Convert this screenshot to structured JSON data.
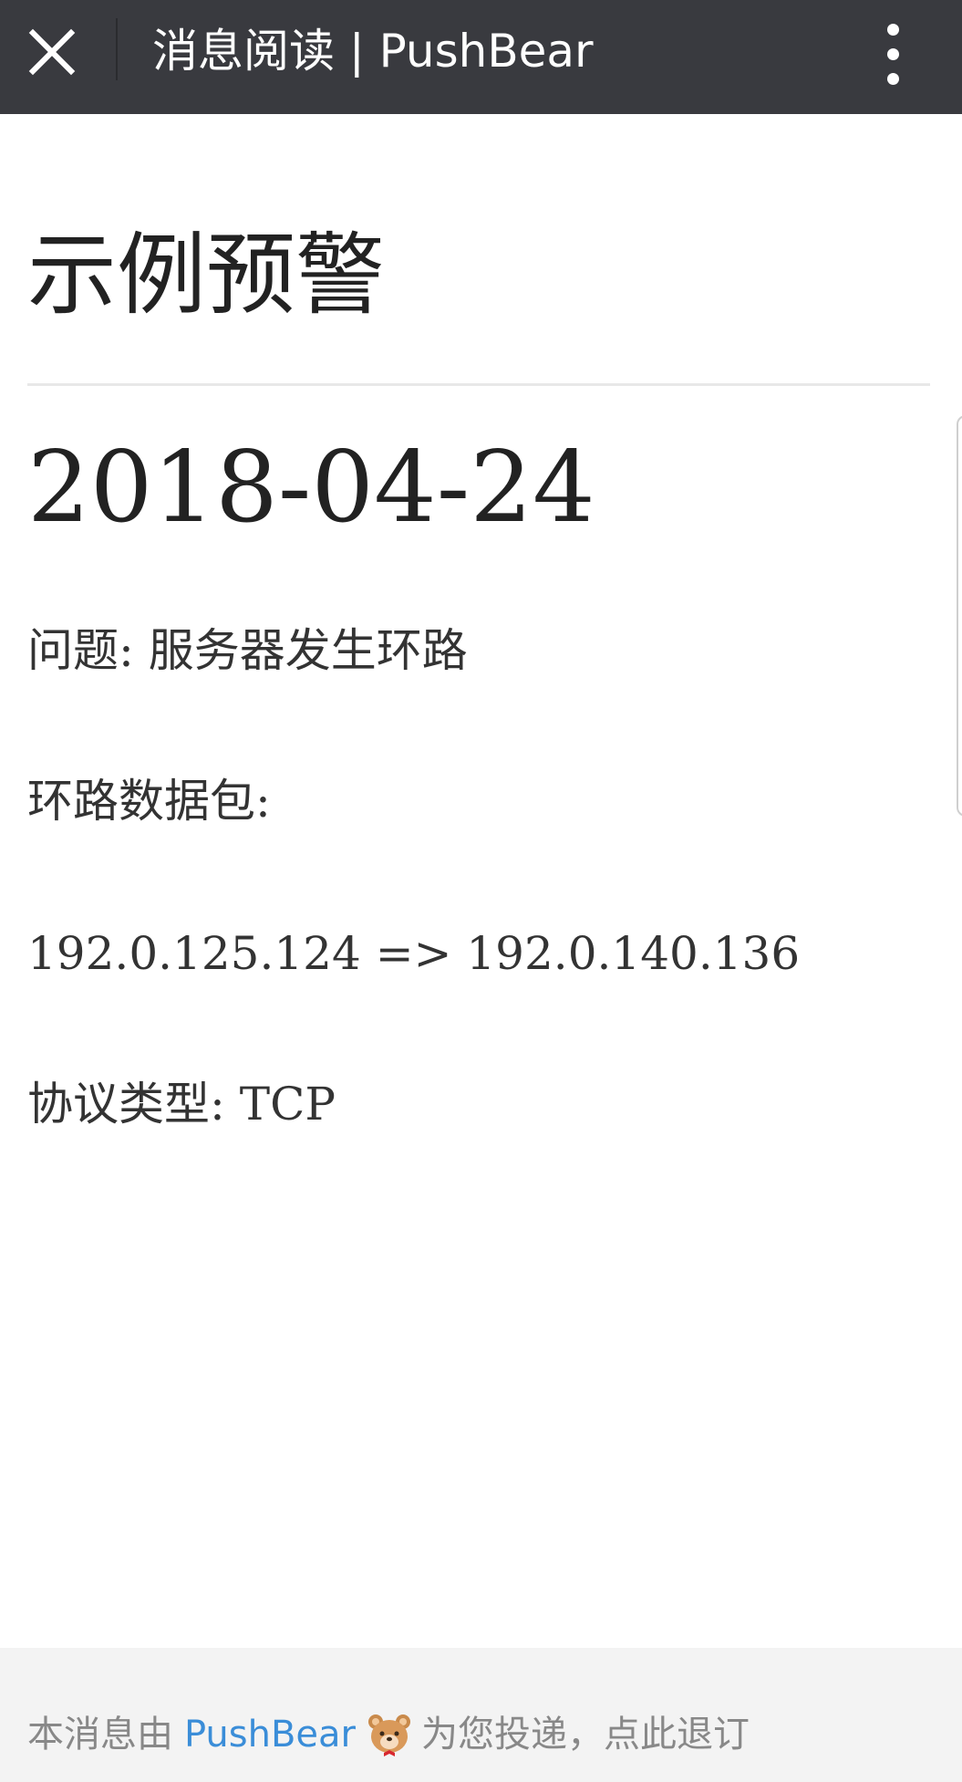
{
  "header": {
    "title": "消息阅读 | PushBear",
    "close_icon": "close-icon",
    "more_icon": "more-vertical-icon",
    "bg_color": "#393a3f"
  },
  "message": {
    "title": "示例预警",
    "date": "2018-04-24",
    "lines": [
      "问题: 服务器发生环路",
      "环路数据包:",
      "192.0.125.124 => 192.0.140.136",
      "协议类型: TCP"
    ]
  },
  "footer": {
    "prefix": "本消息由",
    "brand_link": "PushBear",
    "brand_icon": "bear-icon",
    "suffix": "为您投递，",
    "unsubscribe": "点此退订",
    "link_color": "#3a8dd8"
  }
}
